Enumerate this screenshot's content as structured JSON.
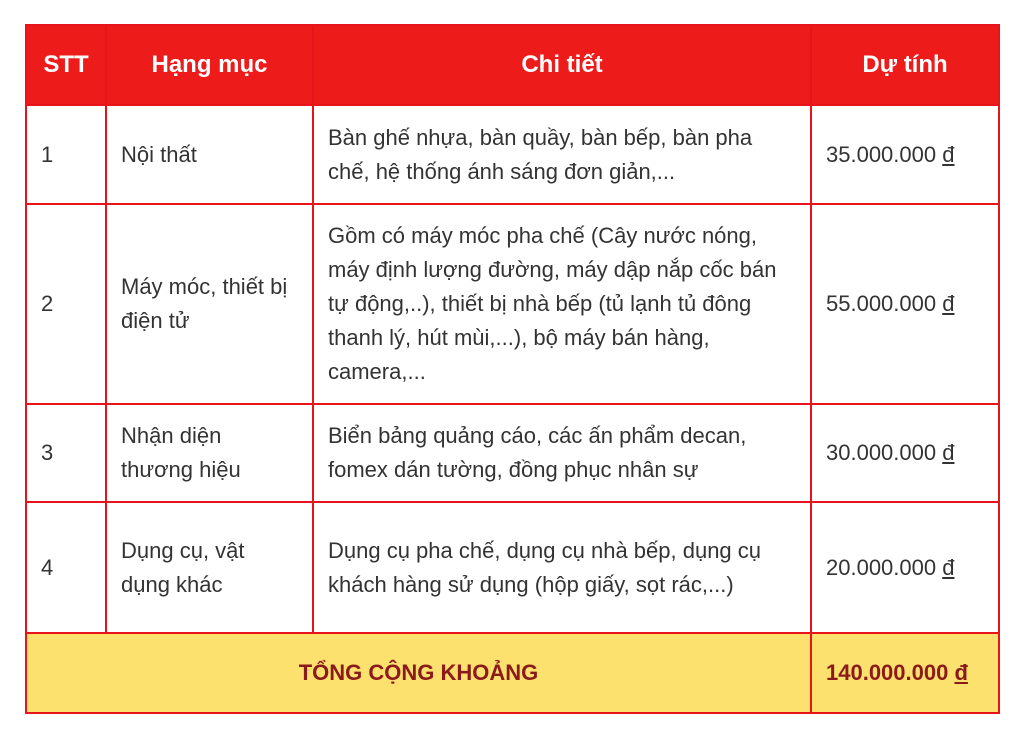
{
  "header": {
    "stt": "STT",
    "category": "Hạng mục",
    "detail": "Chi tiết",
    "estimate": "Dự tính"
  },
  "rows": [
    {
      "stt": "1",
      "category": "Nội thất",
      "detail": "Bàn ghế nhựa, bàn quầy, bàn bếp, bàn pha chế, hệ thống ánh sáng đơn giản,...",
      "amount": "35.000.000",
      "currency": "đ"
    },
    {
      "stt": "2",
      "category": "Máy móc, thiết bị điện tử",
      "detail": "Gồm có máy móc pha chế (Cây nước nóng, máy định lượng đường, máy dập nắp cốc bán tự động,..), thiết bị nhà bếp (tủ lạnh tủ đông thanh lý, hút mùi,...), bộ máy bán hàng, camera,...",
      "amount": "55.000.000",
      "currency": "đ"
    },
    {
      "stt": "3",
      "category": "Nhận diện thương hiệu",
      "detail": "Biển bảng quảng cáo, các ấn phẩm decan, fomex dán tường, đồng phục nhân sự",
      "amount": "30.000.000",
      "currency": "đ"
    },
    {
      "stt": "4",
      "category": "Dụng cụ, vật dụng khác",
      "detail": "Dụng cụ pha chế, dụng cụ nhà bếp, dụng cụ khách hàng sử dụng (hộp giấy, sọt rác,...)",
      "amount": "20.000.000",
      "currency": "đ"
    }
  ],
  "total": {
    "label": "TỔNG CỘNG KHOẢNG",
    "amount": "140.000.000",
    "currency": "đ"
  },
  "colors": {
    "header_bg": "#ee1b1b",
    "border": "#e8141c",
    "total_bg": "#fce16e",
    "total_text": "#8b1a1a"
  }
}
